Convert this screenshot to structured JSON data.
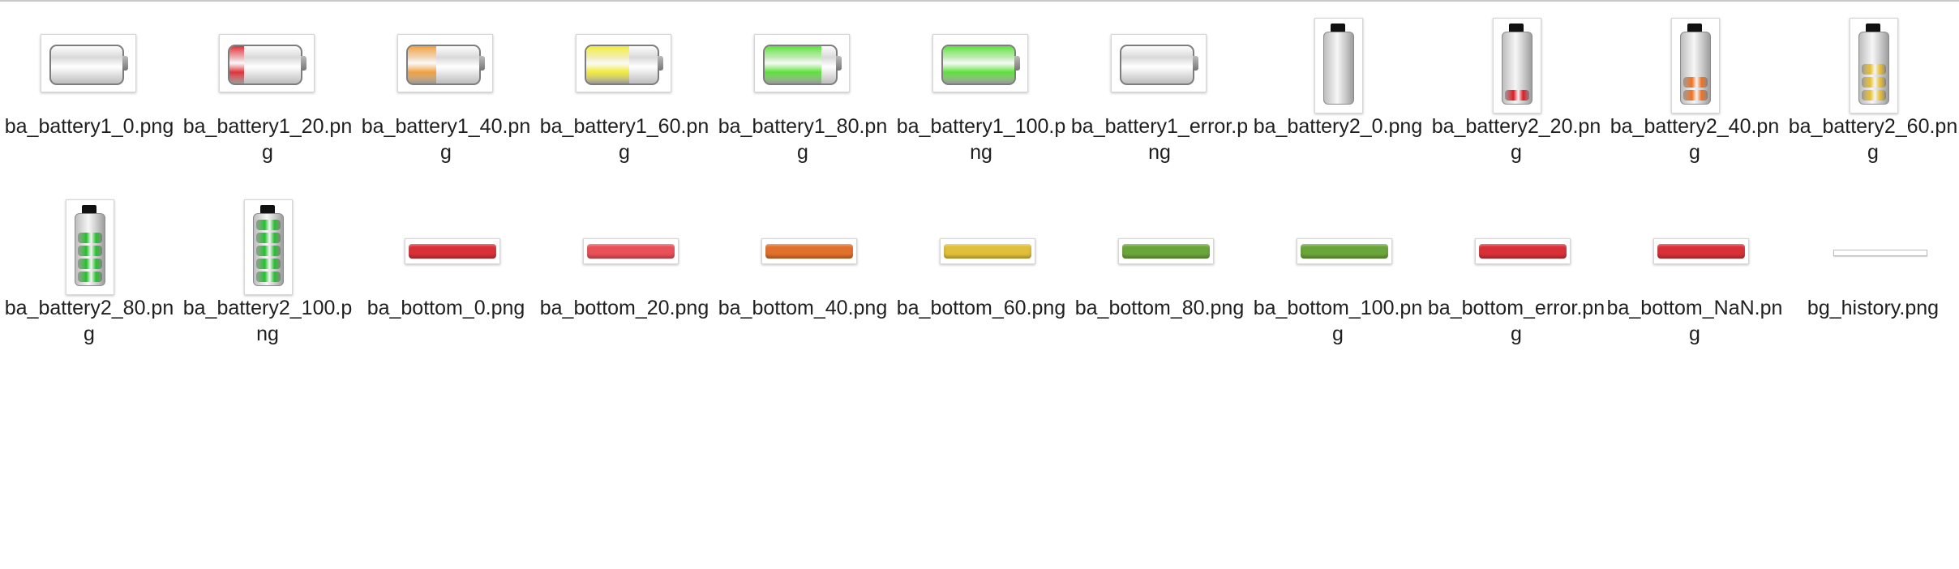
{
  "files": [
    {
      "name": "ba_battery1_0.png",
      "kind": "battery1",
      "fill": 0,
      "color": ""
    },
    {
      "name": "ba_battery1_20.png",
      "kind": "battery1",
      "fill": 0.2,
      "color": "#e1323a"
    },
    {
      "name": "ba_battery1_40.png",
      "kind": "battery1",
      "fill": 0.4,
      "color": "#f0a040"
    },
    {
      "name": "ba_battery1_60.png",
      "kind": "battery1",
      "fill": 0.6,
      "color": "#f0ea3c"
    },
    {
      "name": "ba_battery1_80.png",
      "kind": "battery1",
      "fill": 0.8,
      "color": "#5fe03b"
    },
    {
      "name": "ba_battery1_100.png",
      "kind": "battery1",
      "fill": 1.0,
      "color": "#5fe03b"
    },
    {
      "name": "ba_battery1_error.png",
      "kind": "battery1",
      "fill": 0,
      "color": ""
    },
    {
      "name": "ba_battery2_0.png",
      "kind": "battery2",
      "fill": 0,
      "color": ""
    },
    {
      "name": "ba_battery2_20.png",
      "kind": "battery2",
      "fill": 0.2,
      "color": "#e01822"
    },
    {
      "name": "ba_battery2_40.png",
      "kind": "battery2",
      "fill": 0.4,
      "color": "#f07020"
    },
    {
      "name": "ba_battery2_60.png",
      "kind": "battery2",
      "fill": 0.6,
      "color": "#e8c030"
    },
    {
      "name": "ba_battery2_80.png",
      "kind": "battery2",
      "fill": 0.8,
      "color": "#22c02a"
    },
    {
      "name": "ba_battery2_100.png",
      "kind": "battery2",
      "fill": 1.0,
      "color": "#22c02a"
    },
    {
      "name": "ba_bottom_0.png",
      "kind": "bottom",
      "color": "#d93038"
    },
    {
      "name": "ba_bottom_20.png",
      "kind": "bottom",
      "color": "#ea5058"
    },
    {
      "name": "ba_bottom_40.png",
      "kind": "bottom",
      "color": "#e0702a"
    },
    {
      "name": "ba_bottom_60.png",
      "kind": "bottom",
      "color": "#e0bf3a"
    },
    {
      "name": "ba_bottom_80.png",
      "kind": "bottom",
      "color": "#6aa53a"
    },
    {
      "name": "ba_bottom_100.png",
      "kind": "bottom",
      "color": "#6aa53a"
    },
    {
      "name": "ba_bottom_error.png",
      "kind": "bottom",
      "color": "#d93038"
    },
    {
      "name": "ba_bottom_NaN.png",
      "kind": "bottom",
      "color": "#d93038"
    },
    {
      "name": "bg_history.png",
      "kind": "history",
      "color": ""
    }
  ]
}
